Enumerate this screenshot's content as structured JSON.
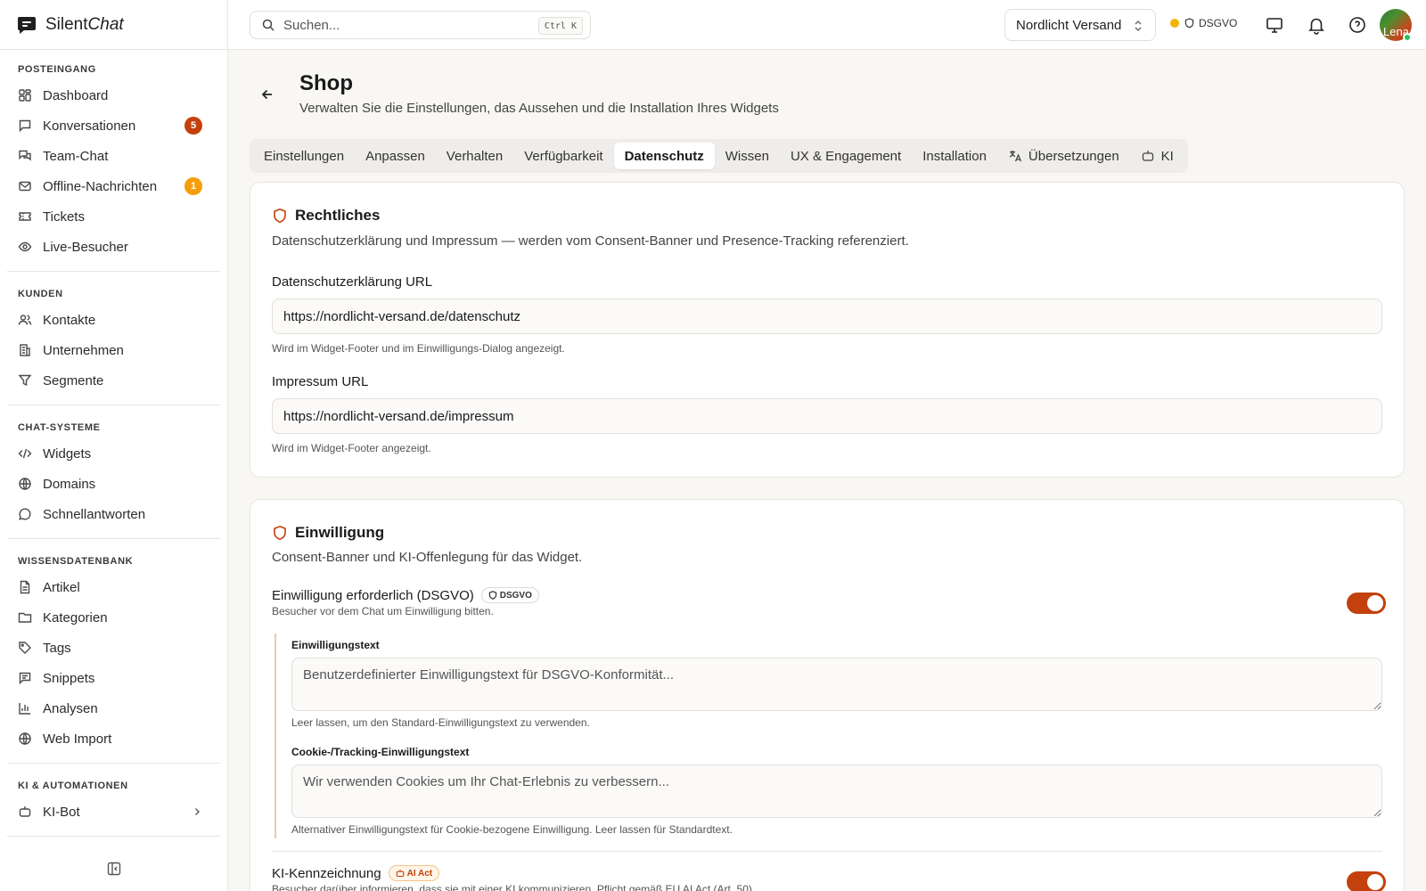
{
  "app": {
    "logo_primary": "Silent",
    "logo_secondary": "Chat"
  },
  "sidebar": {
    "sections": [
      {
        "title": "POSTEINGANG",
        "items": [
          {
            "label": "Dashboard",
            "icon": "dashboard-icon"
          },
          {
            "label": "Konversationen",
            "icon": "message-square-icon",
            "badge": "5"
          },
          {
            "label": "Team-Chat",
            "icon": "messages-icon"
          },
          {
            "label": "Offline-Nachrichten",
            "icon": "mail-icon",
            "badge": "1"
          },
          {
            "label": "Tickets",
            "icon": "ticket-icon"
          },
          {
            "label": "Live-Besucher",
            "icon": "eye-icon"
          }
        ]
      },
      {
        "title": "KUNDEN",
        "items": [
          {
            "label": "Kontakte",
            "icon": "users-icon"
          },
          {
            "label": "Unternehmen",
            "icon": "building-icon"
          },
          {
            "label": "Segmente",
            "icon": "filter-icon"
          }
        ]
      },
      {
        "title": "CHAT-SYSTEME",
        "items": [
          {
            "label": "Widgets",
            "icon": "code-icon"
          },
          {
            "label": "Domains",
            "icon": "globe-icon"
          },
          {
            "label": "Schnellantworten",
            "icon": "message-circle-icon"
          }
        ]
      },
      {
        "title": "WISSENSDATENBANK",
        "items": [
          {
            "label": "Artikel",
            "icon": "file-text-icon"
          },
          {
            "label": "Kategorien",
            "icon": "folder-icon"
          },
          {
            "label": "Tags",
            "icon": "tag-icon"
          },
          {
            "label": "Snippets",
            "icon": "snippet-icon"
          },
          {
            "label": "Analysen",
            "icon": "bar-chart-icon"
          },
          {
            "label": "Web Import",
            "icon": "globe-icon"
          }
        ]
      },
      {
        "title": "KI & AUTOMATIONEN",
        "items": [
          {
            "label": "KI-Bot",
            "icon": "bot-icon"
          }
        ]
      }
    ],
    "badge_colors": {
      "red": "#c2410c",
      "amber": "#f59e0b"
    }
  },
  "topbar": {
    "search_placeholder": "Suchen...",
    "search_shortcut": "Ctrl K",
    "org_name": "Nordlicht Versand",
    "compliance_label": "DSGVO",
    "avatar_initials": "Lena"
  },
  "page": {
    "title": "Shop",
    "subtitle": "Verwalten Sie die Einstellungen, das Aussehen und die Installation Ihres Widgets",
    "tabs": [
      {
        "label": "Einstellungen"
      },
      {
        "label": "Anpassen"
      },
      {
        "label": "Verhalten"
      },
      {
        "label": "Verfügbarkeit"
      },
      {
        "label": "Datenschutz",
        "active": true
      },
      {
        "label": "Wissen"
      },
      {
        "label": "UX & Engagement"
      },
      {
        "label": "Installation"
      },
      {
        "label": "Übersetzungen",
        "icon": "translate-icon"
      },
      {
        "label": "KI",
        "icon": "bot-icon"
      }
    ]
  },
  "legal": {
    "title": "Rechtliches",
    "description": "Datenschutzerklärung und Impressum — werden vom Consent-Banner und Presence-Tracking referenziert.",
    "privacy_label": "Datenschutzerklärung URL",
    "privacy_value": "https://nordlicht-versand.de/datenschutz",
    "privacy_help": "Wird im Widget-Footer und im Einwilligungs-Dialog angezeigt.",
    "imprint_label": "Impressum URL",
    "imprint_value": "https://nordlicht-versand.de/impressum",
    "imprint_help": "Wird im Widget-Footer angezeigt."
  },
  "consent": {
    "title": "Einwilligung",
    "description": "Consent-Banner und KI-Offenlegung für das Widget.",
    "required_label": "Einwilligung erforderlich (DSGVO)",
    "required_badge": "DSGVO",
    "required_sub": "Besucher vor dem Chat um Einwilligung bitten.",
    "required_on": true,
    "text_label": "Einwilligungstext",
    "text_placeholder": "Benutzerdefinierter Einwilligungstext für DSGVO-Konformität...",
    "text_help": "Leer lassen, um den Standard-Einwilligungstext zu verwenden.",
    "cookie_label": "Cookie-/Tracking-Einwilligungstext",
    "cookie_placeholder": "Wir verwenden Cookies um Ihr Chat-Erlebnis zu verbessern...",
    "cookie_help": "Alternativer Einwilligungstext für Cookie-bezogene Einwilligung. Leer lassen für Standardtext.",
    "ai_label": "KI-Kennzeichnung",
    "ai_badge": "AI Act",
    "ai_sub": "Besucher darüber informieren, dass sie mit einer KI kommunizieren. Pflicht gemäß EU AI Act (Art. 50).",
    "ai_on": true,
    "accent": "#c2410c"
  }
}
